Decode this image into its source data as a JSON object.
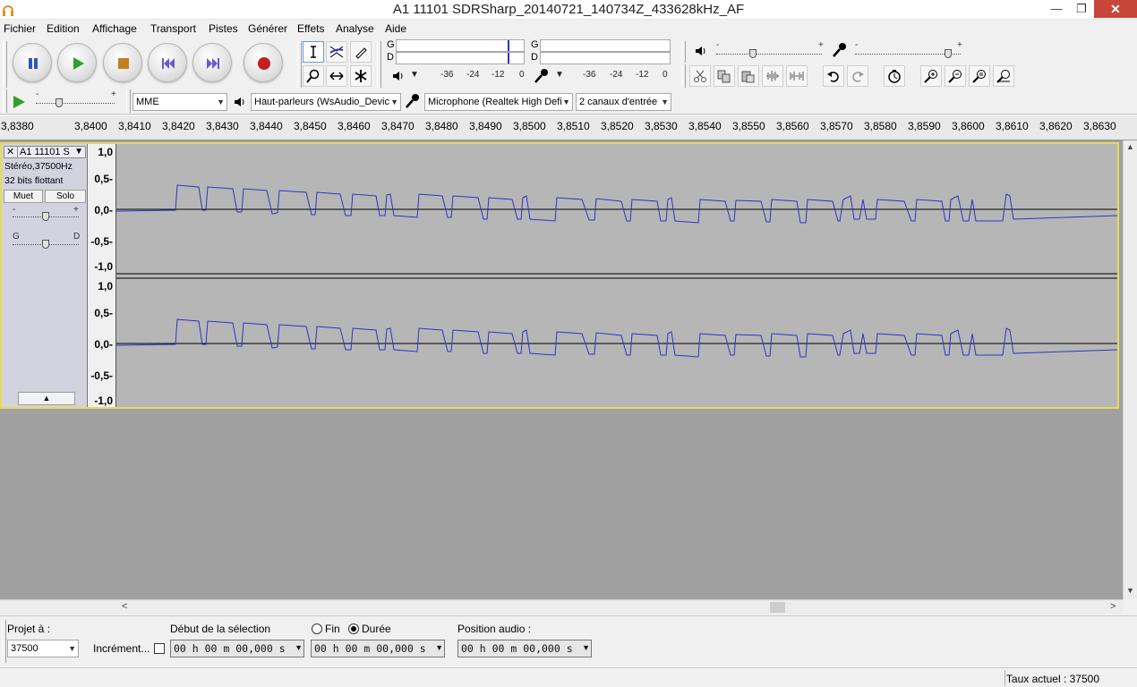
{
  "window": {
    "title": "A1 11101 SDRSharp_20140721_140734Z_433628kHz_AF",
    "controls": {
      "minimize": "—",
      "maximize": "❐",
      "close": "✕"
    }
  },
  "menu": [
    "Fichier",
    "Edition",
    "Affichage",
    "Transport",
    "Pistes",
    "Générer",
    "Effets",
    "Analyse",
    "Aide"
  ],
  "meters": {
    "left_letter": "G",
    "right_letter": "D",
    "scale": [
      "-36",
      "-24",
      "-12",
      "0"
    ]
  },
  "playback_slider": {
    "minus": "-",
    "plus": "+",
    "level": 0.35
  },
  "record_slider": {
    "minus": "-",
    "plus": "+",
    "level": 0.88
  },
  "play_speed_slider": {
    "minus": "-",
    "plus": "+",
    "level": 0.3
  },
  "devices": {
    "host": "MME",
    "output": "Haut-parleurs (WsAudio_Devic",
    "input": "Microphone (Realtek High Defi",
    "channels": "2 canaux d'entrée"
  },
  "ruler": {
    "labels": [
      "3,8380",
      "3,8400",
      "3,8410",
      "3,8420",
      "3,8430",
      "3,8440",
      "3,8450",
      "3,8460",
      "3,8470",
      "3,8480",
      "3,8490",
      "3,8500",
      "3,8510",
      "3,8520",
      "3,8530",
      "3,8540",
      "3,8550",
      "3,8560",
      "3,8570",
      "3,8580",
      "3,8590",
      "3,8600",
      "3,8610",
      "3,8620",
      "3,8630"
    ]
  },
  "track": {
    "name": "A1 11101 S",
    "close": "✕",
    "menu_arrow": "▼",
    "rate_info": "Stéréo,37500Hz",
    "format_info": "32 bits flottant",
    "mute_label": "Muet",
    "solo_label": "Solo",
    "gain": {
      "minus": "-",
      "plus": "+",
      "level": 0.5
    },
    "pan": {
      "left": "G",
      "right": "D",
      "level": 0.5
    },
    "collapse_arrow": "▲",
    "vruler_labels": [
      "1,0",
      "0,5-",
      "0,0-",
      "-0,5-",
      "-1,0"
    ]
  },
  "scrollbar": {
    "left_arrow": "<",
    "right_arrow": ">",
    "up_arrow": "▲",
    "down_arrow": "▼"
  },
  "selection": {
    "rate_label": "Projet à :",
    "rate_value": "37500",
    "snap_label": "Incrément...",
    "start_label": "Début de la sélection",
    "end_label": "Fin",
    "length_label": "Durée",
    "audio_pos_label": "Position audio :",
    "start_value": "00 h 00 m 00,000 s",
    "end_value": "00 h 00 m 00,000 s",
    "audio_pos_value": "00 h 00 m 00,000 s"
  },
  "status": {
    "rate_text": "Taux actuel : 37500"
  },
  "colors": {
    "waveform": "#3232c8",
    "track_border": "#e8d95a",
    "wave_bg": "#b6b6b6",
    "record": "#c42020",
    "play": "#2ea02e",
    "pause": "#2c58b8",
    "close": "#c7453a"
  }
}
